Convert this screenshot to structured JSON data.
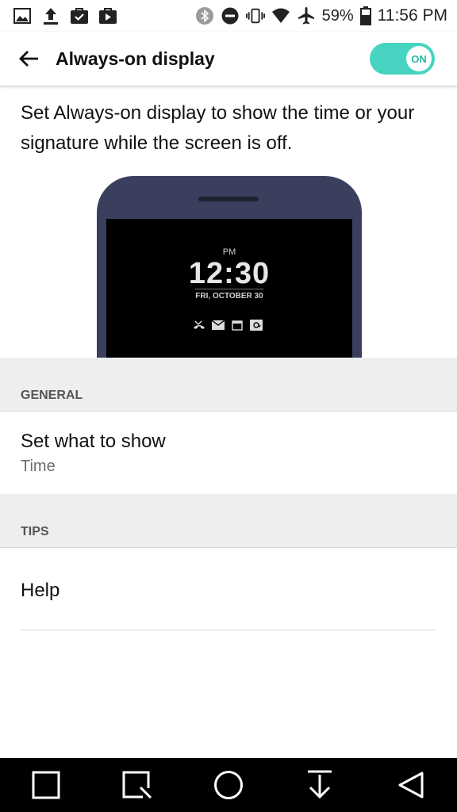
{
  "status_bar": {
    "left_icons": [
      "gallery-icon",
      "upload-icon",
      "briefcase-check-icon",
      "briefcase-play-icon"
    ],
    "right_icons": [
      "bluetooth-icon",
      "do-not-disturb-icon",
      "vibrate-icon",
      "wifi-icon",
      "airplane-mode-icon",
      "battery-icon"
    ],
    "battery": "59%",
    "time": "11:56 PM"
  },
  "app_bar": {
    "title": "Always-on display",
    "toggle_label": "ON",
    "toggle_color": "#46d4c0"
  },
  "description": "Set Always-on display to show the time or your signature while the screen is off.",
  "preview": {
    "ampm": "PM",
    "time": "12:30",
    "date": "FRI, OCTOBER 30",
    "icons": [
      "missed-call-icon",
      "mail-icon",
      "calendar-icon",
      "email-at-icon"
    ]
  },
  "sections": {
    "general": {
      "header": "GENERAL",
      "items": [
        {
          "title": "Set what to show",
          "subtitle": "Time"
        }
      ]
    },
    "tips": {
      "header": "TIPS",
      "items": [
        {
          "title": "Help"
        }
      ]
    }
  },
  "nav_bar": {
    "buttons": [
      "recents-icon",
      "capture-icon",
      "home-icon",
      "notification-pull-icon",
      "back-icon"
    ]
  }
}
